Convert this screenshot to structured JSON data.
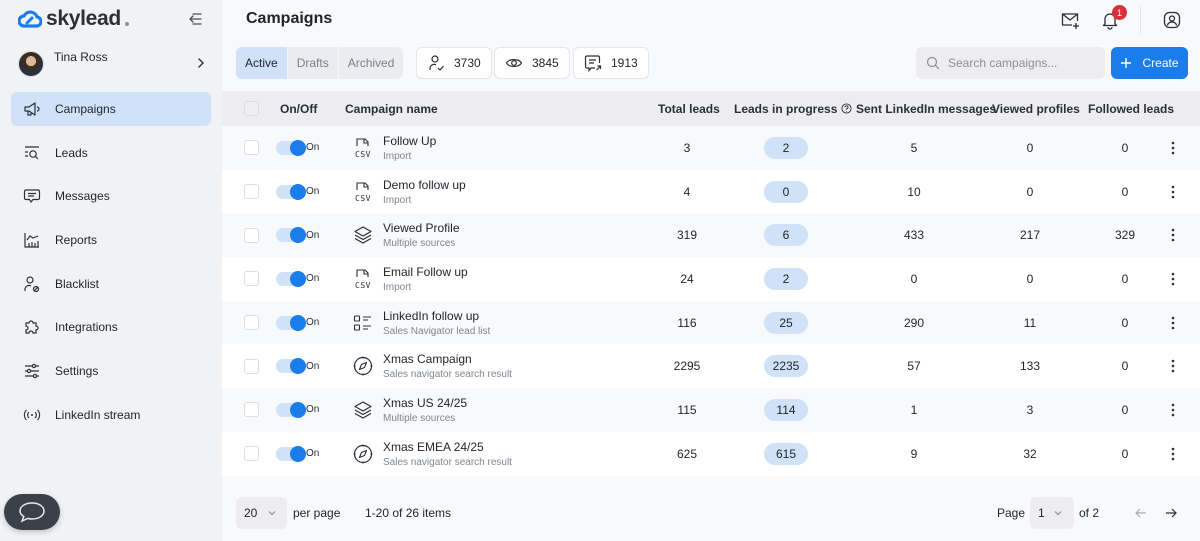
{
  "app": {
    "logo_text": "skylead",
    "user_name": "Tina Ross"
  },
  "sidebar": {
    "items": [
      {
        "label": "Campaigns",
        "icon": "megaphone-icon",
        "active": true
      },
      {
        "label": "Leads",
        "icon": "leads-search-icon"
      },
      {
        "label": "Messages",
        "icon": "message-icon"
      },
      {
        "label": "Reports",
        "icon": "chart-icon"
      },
      {
        "label": "Blacklist",
        "icon": "user-block-icon"
      },
      {
        "label": "Integrations",
        "icon": "puzzle-icon"
      },
      {
        "label": "Settings",
        "icon": "sliders-icon"
      },
      {
        "label": "LinkedIn stream",
        "icon": "broadcast-icon"
      }
    ]
  },
  "header": {
    "title": "Campaigns",
    "notification_count": "1"
  },
  "tabs": [
    {
      "label": "Active",
      "active": true
    },
    {
      "label": "Drafts"
    },
    {
      "label": "Archived"
    }
  ],
  "stats": [
    {
      "icon": "user-check-icon",
      "value": "3730"
    },
    {
      "icon": "eye-icon",
      "value": "3845"
    },
    {
      "icon": "message-sent-icon",
      "value": "1913"
    }
  ],
  "search": {
    "placeholder": "Search campaigns...",
    "value": ""
  },
  "create_label": "Create",
  "table": {
    "columns": [
      "On/Off",
      "Campaign name",
      "Total leads",
      "Leads in progress",
      "Sent LinkedIn messages",
      "Viewed profiles",
      "Followed leads"
    ],
    "rows": [
      {
        "toggle": "On",
        "name": "Follow Up",
        "source": "Import",
        "source_icon": "csv-icon",
        "total": "3",
        "in_progress": "2",
        "sent": "5",
        "viewed": "0",
        "followed": "0"
      },
      {
        "toggle": "On",
        "name": "Demo follow up",
        "source": "Import",
        "source_icon": "csv-icon",
        "total": "4",
        "in_progress": "0",
        "sent": "10",
        "viewed": "0",
        "followed": "0"
      },
      {
        "toggle": "On",
        "name": "Viewed Profile",
        "source": "Multiple sources",
        "source_icon": "layers-icon",
        "total": "319",
        "in_progress": "6",
        "sent": "433",
        "viewed": "217",
        "followed": "329"
      },
      {
        "toggle": "On",
        "name": "Email Follow up",
        "source": "Import",
        "source_icon": "csv-icon",
        "total": "24",
        "in_progress": "2",
        "sent": "0",
        "viewed": "0",
        "followed": "0"
      },
      {
        "toggle": "On",
        "name": "LinkedIn follow up",
        "source": "Sales Navigator lead list",
        "source_icon": "list-icon",
        "total": "116",
        "in_progress": "25",
        "sent": "290",
        "viewed": "11",
        "followed": "0"
      },
      {
        "toggle": "On",
        "name": "Xmas Campaign",
        "source": "Sales navigator search result",
        "source_icon": "compass-icon",
        "total": "2295",
        "in_progress": "2235",
        "sent": "57",
        "viewed": "133",
        "followed": "0"
      },
      {
        "toggle": "On",
        "name": "Xmas US 24/25",
        "source": "Multiple sources",
        "source_icon": "layers-icon",
        "total": "115",
        "in_progress": "114",
        "sent": "1",
        "viewed": "3",
        "followed": "0"
      },
      {
        "toggle": "On",
        "name": "Xmas EMEA 24/25",
        "source": "Sales navigator search result",
        "source_icon": "compass-icon",
        "total": "625",
        "in_progress": "615",
        "sent": "9",
        "viewed": "32",
        "followed": "0"
      }
    ]
  },
  "footer": {
    "per_page_value": "20",
    "per_page_label": "per page",
    "range_text": "1-20 of 26 items",
    "page_label": "Page",
    "page_value": "1",
    "page_total": "of 2"
  },
  "colors": {
    "accent": "#1b7cec",
    "active_bg": "#cfe2f7",
    "badge": "#d9303b"
  }
}
